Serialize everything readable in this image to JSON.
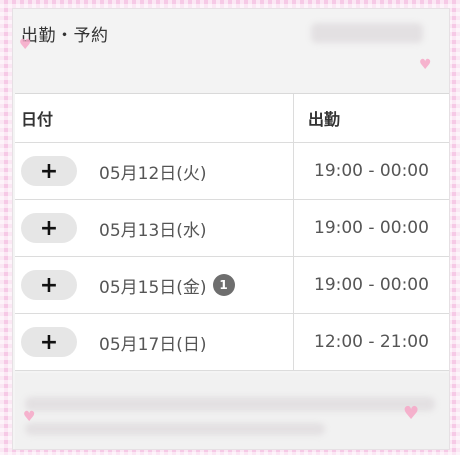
{
  "panel": {
    "title": "出勤・予約"
  },
  "table": {
    "headers": {
      "date": "日付",
      "shift": "出勤"
    },
    "rows": [
      {
        "button": "+",
        "date": "05月12日(火)",
        "badge": "",
        "shift": "19:00 - 00:00"
      },
      {
        "button": "+",
        "date": "05月13日(水)",
        "badge": "",
        "shift": "19:00 - 00:00"
      },
      {
        "button": "+",
        "date": "05月15日(金)",
        "badge": "1",
        "shift": "19:00 - 00:00"
      },
      {
        "button": "+",
        "date": "05月17日(日)",
        "badge": "",
        "shift": "12:00 - 21:00"
      }
    ]
  },
  "colors": {
    "border_pink": "#f6c9e6",
    "heart": "#f7a8c8",
    "badge": "#6e6e6e"
  }
}
